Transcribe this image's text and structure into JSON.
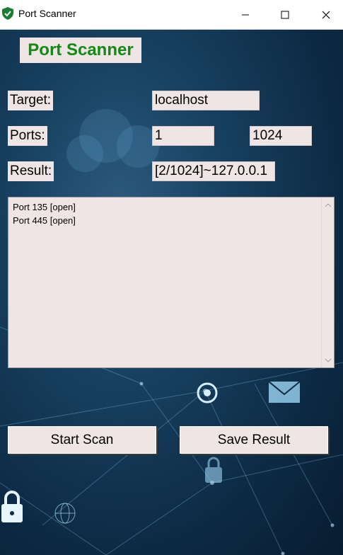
{
  "window": {
    "title": "Port Scanner",
    "icon": "shield-check-icon"
  },
  "app": {
    "heading": "Port Scanner",
    "target_label": "Target:",
    "target_value": "localhost",
    "ports_label": "Ports:",
    "port_start": "1",
    "port_end": "1024",
    "result_label": "Result:",
    "result_value": "[2/1024]~127.0.0.1",
    "result_lines": [
      "Port 135 [open]",
      "Port 445 [open]"
    ],
    "start_button": "Start Scan",
    "save_button": "Save Result"
  },
  "colors": {
    "heading_text": "#138a13",
    "widget_bg": "#efe5e4",
    "background": "#0f2a40"
  }
}
